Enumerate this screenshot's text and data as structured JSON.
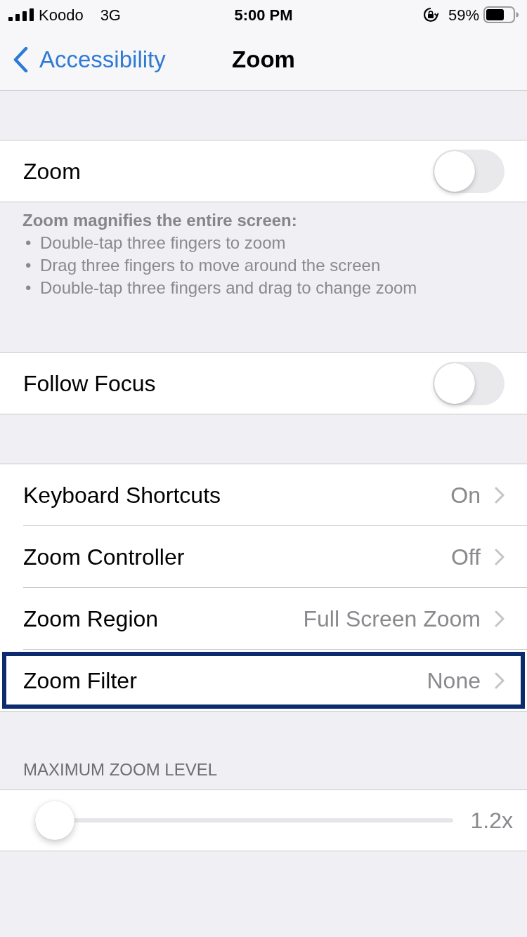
{
  "status_bar": {
    "carrier": "Koodo",
    "network": "3G",
    "time": "5:00 PM",
    "battery": "59%"
  },
  "nav_bar": {
    "back": "Accessibility",
    "title": "Zoom"
  },
  "sections": [
    {
      "kind": "toggles",
      "rows": [
        {
          "label": "Zoom",
          "on": false
        }
      ],
      "footer": {
        "title": "Zoom magnifies the entire screen:",
        "items": [
          {
            "marker": "•",
            "text": "Double-tap three fingers to zoom"
          },
          {
            "marker": "•",
            "text": "Drag three fingers to move around the screen"
          },
          {
            "marker": "•",
            "text": "Double-tap three fingers and drag to change zoom"
          }
        ]
      }
    },
    {
      "kind": "toggles",
      "rows": [
        {
          "label": "Follow Focus",
          "on": false
        }
      ]
    },
    {
      "kind": "links",
      "rows": [
        {
          "label": "Keyboard Shortcuts",
          "value": "On",
          "highlighted": false
        },
        {
          "label": "Zoom Controller",
          "value": "Off",
          "highlighted": false
        },
        {
          "label": "Zoom Region",
          "value": "Full Screen Zoom",
          "highlighted": false
        },
        {
          "label": "Zoom Filter",
          "value": "None",
          "highlighted": true
        }
      ]
    },
    {
      "kind": "slider",
      "header": "MAXIMUM ZOOM LEVEL",
      "level": 0,
      "reading": "1.2x"
    }
  ]
}
